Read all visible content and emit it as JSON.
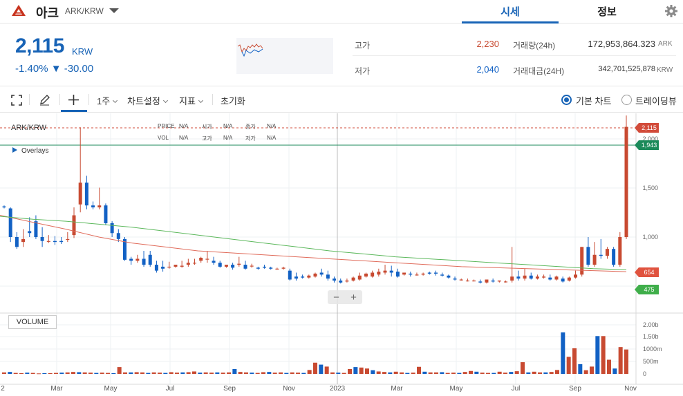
{
  "header": {
    "coin_name": "아크",
    "pair": "ARK/KRW",
    "tabs": [
      {
        "label": "시세"
      },
      {
        "label": "정보"
      }
    ]
  },
  "summary": {
    "price": "2,115",
    "unit": "KRW",
    "change": "-1.40% ▼ -30.00",
    "high_label": "고가",
    "high_value": "2,230",
    "low_label": "저가",
    "low_value": "2,040",
    "volume_label": "거래량(24h)",
    "volume_value": "172,953,864.323",
    "volume_unit": "ARK",
    "amount_label": "거래대금(24H)",
    "amount_value": "342,701,525,878",
    "amount_unit": "KRW"
  },
  "toolbar": {
    "period": "1주",
    "chart_settings": "차트설정",
    "indicators": "지표",
    "reset": "초기화",
    "basic_chart": "기본 차트",
    "tradingview": "트레이딩뷰"
  },
  "chart": {
    "pair_label": "ARK/KRW",
    "overlays_label": "Overlays",
    "info": {
      "price_lbl": "PRICE",
      "price_val": "N/A",
      "open_lbl": "시가",
      "open_val": "N/A",
      "close_lbl": "종가",
      "close_val": "N/A",
      "vol_lbl": "VOL",
      "vol_val": "N/A",
      "high_lbl": "고가",
      "high_val": "N/A",
      "low_lbl": "저가",
      "low_val": "N/A"
    },
    "volume_label": "VOLUME",
    "colors": {
      "up": "#c84a31",
      "down": "#1261c4",
      "ma_short": "#e06b5a",
      "ma_long": "#5cb85c",
      "green_tag": "#1b8a5a"
    }
  },
  "chart_data": {
    "type": "candlestick",
    "price_ticks": [
      "2,000",
      "1,500",
      "1,000"
    ],
    "volume_ticks": [
      "2.00b",
      "1.50b",
      "1000m",
      "500m",
      "0"
    ],
    "x_labels": [
      "2",
      "Mar",
      "May",
      "Jul",
      "Sep",
      "Nov",
      "2023",
      "Mar",
      "May",
      "Jul",
      "Sep",
      "Nov"
    ],
    "price_tags": {
      "last": "2,115",
      "level": "1,943",
      "ma_short": "654",
      "ma_long": "475"
    },
    "candles": [
      [
        1310,
        1320,
        1300,
        1290
      ],
      [
        1290,
        1300,
        1000,
        950
      ],
      [
        1000,
        1050,
        900,
        880
      ],
      [
        950,
        1080,
        980,
        900
      ],
      [
        1060,
        1200,
        1040,
        1000
      ],
      [
        1160,
        1220,
        1000,
        980
      ],
      [
        1000,
        1100,
        960,
        900
      ],
      [
        960,
        1020,
        960,
        940
      ],
      [
        960,
        1010,
        950,
        920
      ],
      [
        960,
        1000,
        950,
        930
      ],
      [
        980,
        1050,
        980,
        950
      ],
      [
        1020,
        1300,
        1220,
        990
      ],
      [
        1330,
        2110,
        1550,
        1250
      ],
      [
        1550,
        1620,
        1320,
        1280
      ],
      [
        1320,
        1360,
        1300,
        1280
      ],
      [
        1300,
        1500,
        1320,
        1280
      ],
      [
        1320,
        1340,
        1140,
        1120
      ],
      [
        1140,
        1160,
        1040,
        1000
      ],
      [
        1040,
        1080,
        980,
        950
      ],
      [
        980,
        1000,
        770,
        760
      ],
      [
        780,
        800,
        760,
        720
      ],
      [
        760,
        820,
        780,
        740
      ],
      [
        780,
        860,
        720,
        700
      ],
      [
        820,
        860,
        720,
        700
      ],
      [
        720,
        760,
        660,
        640
      ],
      [
        700,
        760,
        680,
        650
      ],
      [
        700,
        750,
        700,
        680
      ],
      [
        700,
        720,
        720,
        690
      ],
      [
        700,
        760,
        710,
        690
      ],
      [
        720,
        780,
        740,
        700
      ],
      [
        740,
        780,
        740,
        720
      ],
      [
        760,
        800,
        790,
        740
      ],
      [
        780,
        860,
        780,
        740
      ],
      [
        760,
        800,
        740,
        720
      ],
      [
        740,
        760,
        700,
        690
      ],
      [
        700,
        720,
        720,
        690
      ],
      [
        720,
        740,
        690,
        670
      ],
      [
        720,
        800,
        730,
        700
      ],
      [
        720,
        760,
        680,
        670
      ],
      [
        710,
        730,
        710,
        690
      ],
      [
        690,
        700,
        680,
        670
      ],
      [
        700,
        720,
        690,
        680
      ],
      [
        690,
        700,
        680,
        670
      ],
      [
        680,
        690,
        680,
        670
      ],
      [
        680,
        700,
        690,
        670
      ],
      [
        660,
        680,
        570,
        560
      ],
      [
        600,
        640,
        580,
        560
      ],
      [
        600,
        620,
        590,
        580
      ],
      [
        590,
        620,
        610,
        580
      ],
      [
        600,
        640,
        630,
        590
      ],
      [
        640,
        680,
        620,
        600
      ],
      [
        620,
        660,
        580,
        560
      ],
      [
        580,
        600,
        560,
        540
      ],
      [
        560,
        580,
        540,
        530
      ],
      [
        550,
        580,
        560,
        540
      ],
      [
        560,
        600,
        590,
        550
      ],
      [
        570,
        640,
        610,
        560
      ],
      [
        600,
        640,
        630,
        590
      ],
      [
        600,
        660,
        640,
        590
      ],
      [
        620,
        680,
        650,
        600
      ],
      [
        640,
        720,
        660,
        620
      ],
      [
        660,
        710,
        640,
        600
      ],
      [
        650,
        680,
        600,
        590
      ],
      [
        620,
        640,
        640,
        610
      ],
      [
        630,
        650,
        620,
        600
      ],
      [
        620,
        640,
        620,
        610
      ],
      [
        620,
        640,
        630,
        610
      ],
      [
        640,
        650,
        630,
        620
      ],
      [
        640,
        660,
        630,
        610
      ],
      [
        620,
        640,
        610,
        600
      ],
      [
        610,
        620,
        590,
        580
      ],
      [
        580,
        600,
        570,
        560
      ],
      [
        570,
        580,
        570,
        560
      ],
      [
        560,
        580,
        560,
        550
      ],
      [
        560,
        570,
        560,
        550
      ],
      [
        550,
        570,
        540,
        530
      ],
      [
        540,
        560,
        570,
        530
      ],
      [
        560,
        580,
        550,
        540
      ],
      [
        550,
        560,
        560,
        540
      ],
      [
        550,
        560,
        550,
        540
      ],
      [
        560,
        900,
        600,
        540
      ],
      [
        600,
        660,
        580,
        560
      ],
      [
        580,
        680,
        610,
        560
      ],
      [
        610,
        640,
        580,
        570
      ],
      [
        580,
        620,
        600,
        570
      ],
      [
        590,
        620,
        600,
        580
      ],
      [
        590,
        620,
        570,
        560
      ],
      [
        570,
        610,
        600,
        560
      ],
      [
        580,
        600,
        550,
        540
      ],
      [
        560,
        600,
        590,
        550
      ],
      [
        590,
        660,
        620,
        580
      ],
      [
        620,
        900,
        900,
        600
      ],
      [
        900,
        1000,
        720,
        700
      ],
      [
        720,
        950,
        820,
        700
      ],
      [
        820,
        980,
        810,
        780
      ],
      [
        810,
        900,
        880,
        780
      ],
      [
        880,
        900,
        720,
        700
      ],
      [
        720,
        1050,
        1000,
        700
      ],
      [
        1000,
        2230,
        2115,
        980
      ]
    ],
    "volumes": [
      60,
      80,
      40,
      30,
      50,
      40,
      20,
      30,
      30,
      40,
      50,
      60,
      80,
      70,
      60,
      50,
      40,
      50,
      40,
      30,
      280,
      60,
      60,
      70,
      60,
      40,
      60,
      50,
      40,
      70,
      50,
      60,
      70,
      100,
      50,
      60,
      50,
      60,
      50,
      60,
      200,
      80,
      60,
      50,
      40,
      70,
      80,
      50,
      60,
      40,
      60,
      50,
      40,
      160,
      460,
      380,
      300,
      60,
      50,
      40,
      200,
      280,
      260,
      220,
      150,
      100,
      80,
      60,
      90,
      60,
      40,
      50,
      290,
      90,
      60,
      60,
      70,
      40,
      50,
      40,
      80,
      120,
      90,
      50,
      40,
      40,
      90,
      50,
      80,
      110,
      480,
      60,
      90,
      60,
      60,
      80,
      160,
      1700,
      700,
      1050,
      400,
      150,
      300,
      1550,
      1550,
      580,
      220,
      1100,
      1000
    ],
    "ma_short": [
      1220,
      1150,
      1080,
      1000,
      940,
      900,
      860,
      840,
      820,
      800,
      780,
      760,
      740,
      720,
      700,
      690,
      680,
      670,
      660,
      650
    ],
    "ma_long": [
      1210,
      1180,
      1160,
      1130,
      1100,
      1060,
      1020,
      980,
      940,
      900,
      860,
      830,
      800,
      780,
      760,
      740,
      720,
      700,
      680,
      670
    ]
  }
}
